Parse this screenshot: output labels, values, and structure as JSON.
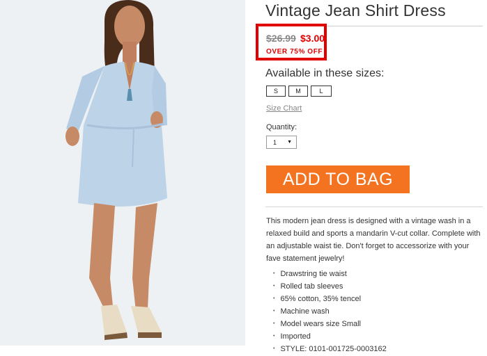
{
  "product": {
    "title": "Vintage Jean Shirt Dress",
    "price_original": "$26.99",
    "price_sale": "$3.00",
    "discount": "OVER 75% OFF",
    "sizes_heading": "Available in these sizes:",
    "sizes": [
      "S",
      "M",
      "L"
    ],
    "size_chart_link": "Size Chart",
    "quantity_label": "Quantity:",
    "quantity_value": "1",
    "add_to_bag": "ADD TO BAG",
    "description": "This modern jean dress is designed with a vintage wash in a relaxed build and sports a mandarin V-cut collar. Complete with an adjustable waist tie. Don't forget to accessorize with your fave statement jewelry!",
    "features": [
      "Drawstring tie waist",
      "Rolled tab sleeves",
      "65% cotton, 35% tencel",
      "Machine wash",
      "Model wears size Small",
      "Imported",
      "STYLE: 0101-001725-0003162"
    ]
  },
  "colors": {
    "accent_red": "#e00000",
    "button_orange": "#f47321",
    "dress_blue": "#bcd3e8"
  }
}
